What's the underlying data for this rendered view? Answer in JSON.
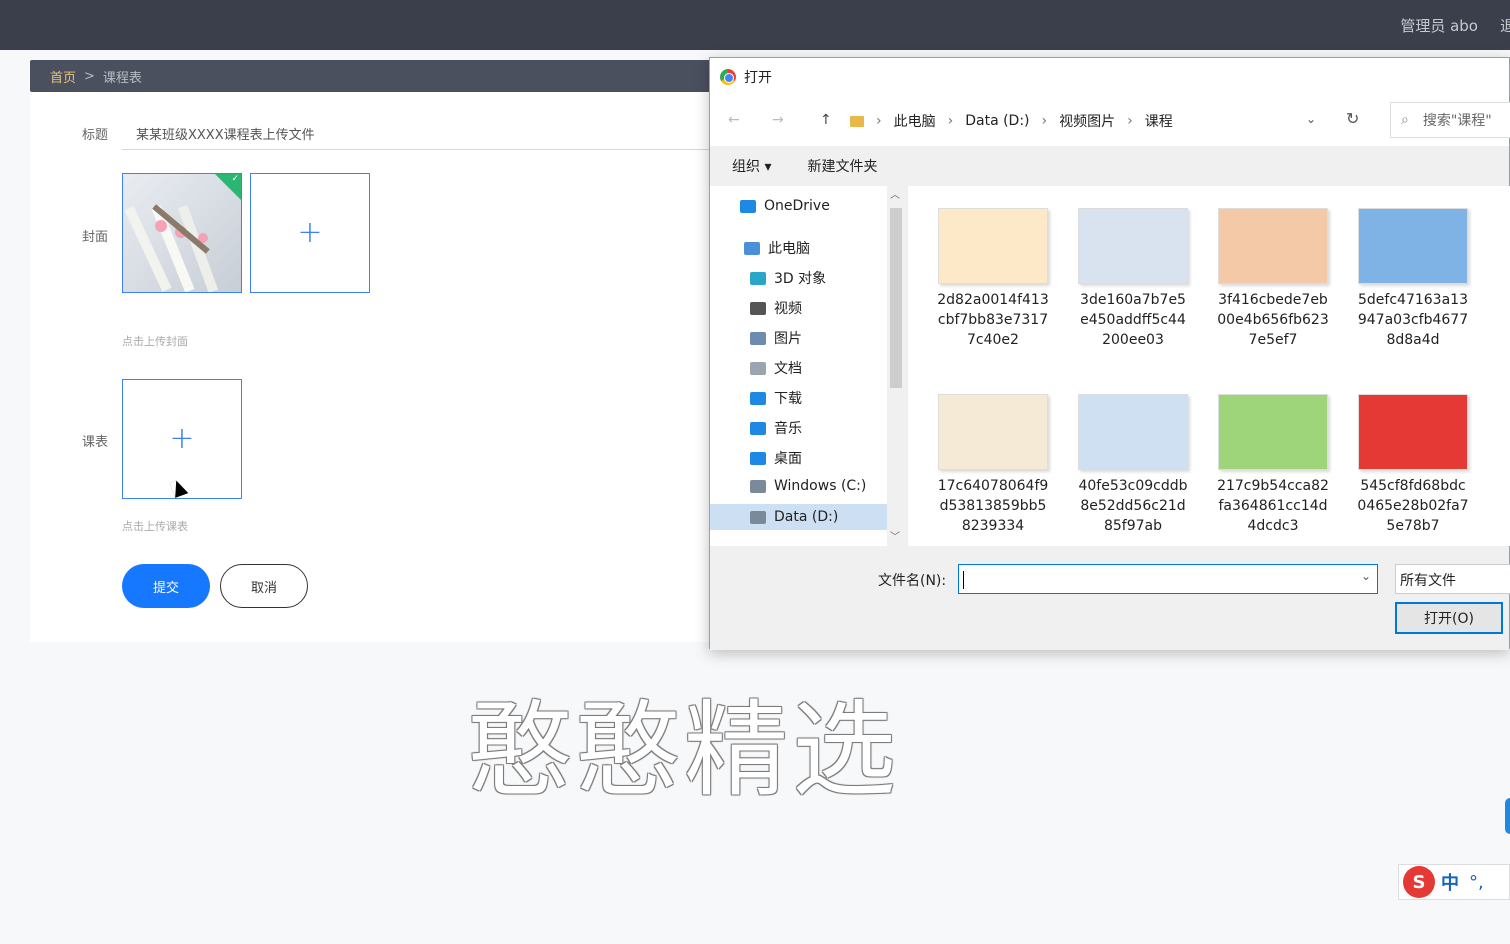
{
  "topbar": {
    "user": "管理员 abo",
    "edge": "退"
  },
  "breadcrumb": {
    "home": "首页",
    "sep": ">",
    "current": "课程表"
  },
  "form": {
    "title_label": "标题",
    "title_value": "某某班级XXXX课程表上传文件",
    "cover_label": "封面",
    "cover_hint": "点击上传封面",
    "schedule_label": "课表",
    "schedule_hint": "点击上传课表",
    "submit": "提交",
    "cancel": "取消",
    "plus": "+"
  },
  "dialog": {
    "title": "打开",
    "path": [
      "此电脑",
      "Data (D:)",
      "视频图片",
      "课程"
    ],
    "search_placeholder": "搜索\"课程\"",
    "organize": "组织 ▾",
    "new_folder": "新建文件夹",
    "nav": [
      {
        "label": "OneDrive",
        "icon": "cloud-icon",
        "color": "#1e88e5"
      },
      {
        "label": "此电脑",
        "icon": "computer-icon",
        "color": "#4a90d9"
      },
      {
        "label": "3D 对象",
        "icon": "cube-icon",
        "color": "#2aa6c9"
      },
      {
        "label": "视频",
        "icon": "film-icon",
        "color": "#555555"
      },
      {
        "label": "图片",
        "icon": "picture-icon",
        "color": "#6b8cae"
      },
      {
        "label": "文档",
        "icon": "document-icon",
        "color": "#9aa5b1"
      },
      {
        "label": "下载",
        "icon": "download-icon",
        "color": "#1e88e5"
      },
      {
        "label": "音乐",
        "icon": "music-icon",
        "color": "#1e88e5"
      },
      {
        "label": "桌面",
        "icon": "desktop-icon",
        "color": "#1e88e5"
      },
      {
        "label": "Windows (C:)",
        "icon": "drive-icon",
        "color": "#7a8a99"
      },
      {
        "label": "Data (D:)",
        "icon": "drive-icon",
        "color": "#7a8a99"
      }
    ],
    "files": [
      {
        "lines": [
          "2d82a0014f413",
          "cbf7bb83e7317",
          "7c40e2"
        ],
        "thumb": "#fde8c8"
      },
      {
        "lines": [
          "3de160a7b7e5",
          "e450addff5c44",
          "200ee03"
        ],
        "thumb": "#d9e3f0"
      },
      {
        "lines": [
          "3f416cbede7eb",
          "00e4b656fb623",
          "7e5ef7"
        ],
        "thumb": "#f4c9a8"
      },
      {
        "lines": [
          "5defc47163a13",
          "947a03cfb4677",
          "8d8a4d"
        ],
        "thumb": "#7fb3e6"
      },
      {
        "lines": [
          "17c64078064f9",
          "d53813859bb5",
          "8239334"
        ],
        "thumb": "#f4ead6"
      },
      {
        "lines": [
          "40fe53c09cddb",
          "8e52dd56c21d",
          "85f97ab"
        ],
        "thumb": "#cfe0f2"
      },
      {
        "lines": [
          "217c9b54cca82",
          "fa364861cc14d",
          "4dcdc3"
        ],
        "thumb": "#9ed47a"
      },
      {
        "lines": [
          "545cf8fd68bdc",
          "0465e28b02fa7",
          "5e78b7"
        ],
        "thumb": "#e53935"
      }
    ],
    "filename_label": "文件名(N):",
    "filetype": "所有文件",
    "open_button": "打开(O)"
  },
  "watermark": "憨憨精选",
  "ime": {
    "logo": "S",
    "lang": "中",
    "punct": "°,"
  }
}
